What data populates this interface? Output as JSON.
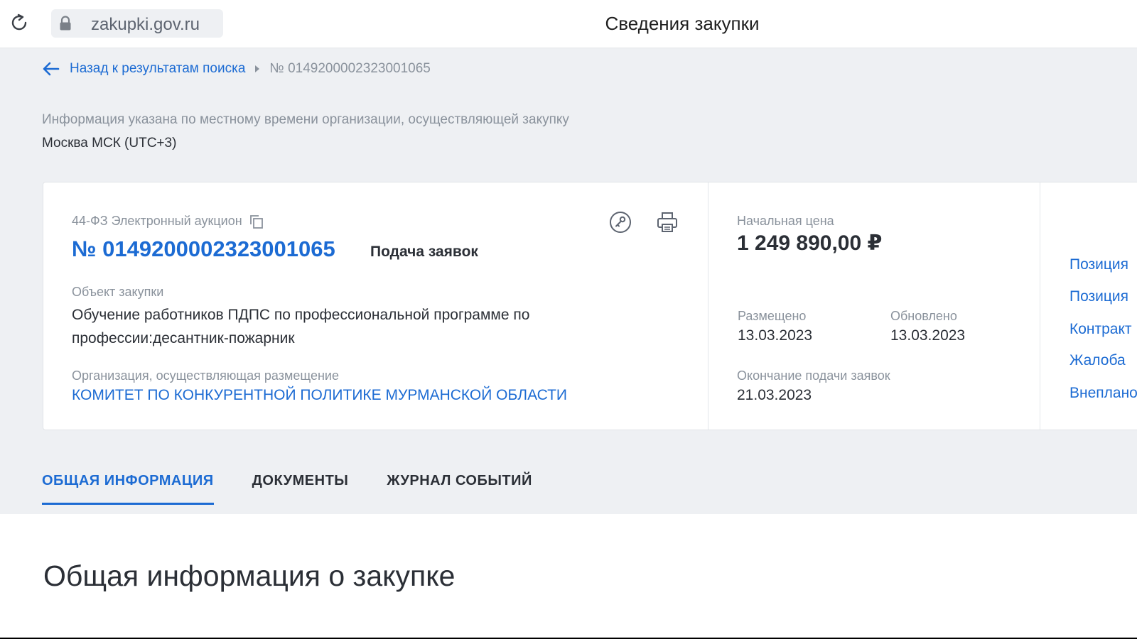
{
  "browser": {
    "url": "zakupki.gov.ru",
    "page_title": "Сведения закупки"
  },
  "breadcrumb": {
    "back_label": "Назад к результатам поиска",
    "current": "№ 0149200002323001065"
  },
  "timezone": {
    "note": "Информация указана по местному времени организации, осуществляющей закупку",
    "value": "Москва МСК (UTC+3)"
  },
  "purchase": {
    "law_type": "44-ФЗ Электронный аукцион",
    "number": "№ 0149200002323001065",
    "status": "Подача заявок",
    "object_label": "Объект закупки",
    "object_value": "Обучение работников ПДПС по профессиональной программе по профессии:десантник-пожарник",
    "org_label": "Организация, осуществляющая размещение",
    "org_value": "КОМИТЕТ ПО КОНКУРЕНТНОЙ ПОЛИТИКЕ МУРМАНСКОЙ ОБЛАСТИ"
  },
  "pricing": {
    "price_label": "Начальная цена",
    "price_value": "1 249 890,00 ₽",
    "posted_label": "Размещено",
    "posted_value": "13.03.2023",
    "updated_label": "Обновлено",
    "updated_value": "13.03.2023",
    "end_label": "Окончание подачи заявок",
    "end_value": "21.03.2023"
  },
  "side_links": [
    "Позиция",
    "Позиция",
    "Контракт",
    "Жалоба",
    "Внеплано"
  ],
  "tabs": [
    {
      "label": "ОБЩАЯ ИНФОРМАЦИЯ",
      "active": true
    },
    {
      "label": "ДОКУМЕНТЫ",
      "active": false
    },
    {
      "label": "ЖУРНАЛ СОБЫТИЙ",
      "active": false
    }
  ],
  "section": {
    "title": "Общая информация о закупке"
  },
  "colors": {
    "accent": "#1c6bd3",
    "text": "#2b2f36",
    "muted": "#8a929c",
    "background": "#eef0f3"
  },
  "icons": [
    "reload-icon",
    "lock-icon",
    "back-arrow-icon",
    "chevron-right-icon",
    "copy-icon",
    "key-icon",
    "print-icon"
  ]
}
